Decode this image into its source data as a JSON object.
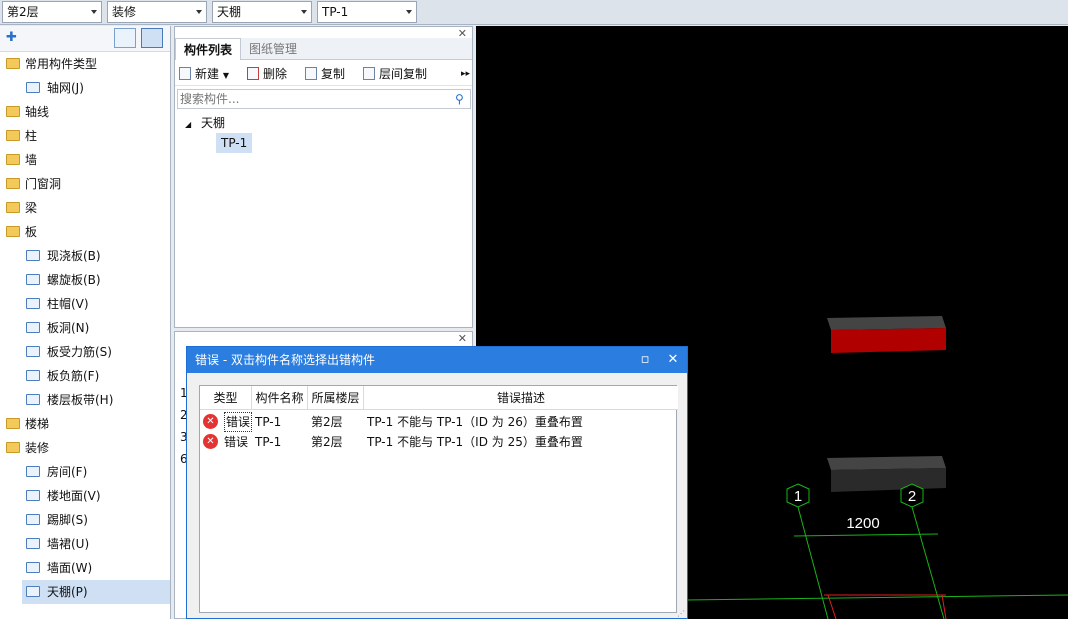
{
  "toolbar": {
    "floor": "第2层",
    "category": "装修",
    "component_type": "天棚",
    "component": "TP-1"
  },
  "left_tree": {
    "items": [
      {
        "label": "常用构件类型",
        "level": 0,
        "icon": "folder-open-icon"
      },
      {
        "label": "轴网(J)",
        "level": 1,
        "icon": "grid-icon"
      },
      {
        "label": "轴线",
        "level": 0,
        "icon": "folder-icon"
      },
      {
        "label": "柱",
        "level": 0,
        "icon": "folder-icon"
      },
      {
        "label": "墙",
        "level": 0,
        "icon": "folder-icon"
      },
      {
        "label": "门窗洞",
        "level": 0,
        "icon": "folder-icon"
      },
      {
        "label": "梁",
        "level": 0,
        "icon": "folder-icon"
      },
      {
        "label": "板",
        "level": 0,
        "icon": "folder-open-icon"
      },
      {
        "label": "现浇板(B)",
        "level": 1,
        "icon": "slab-icon"
      },
      {
        "label": "螺旋板(B)",
        "level": 1,
        "icon": "spiral-slab-icon"
      },
      {
        "label": "柱帽(V)",
        "level": 1,
        "icon": "column-cap-icon"
      },
      {
        "label": "板洞(N)",
        "level": 1,
        "icon": "slab-hole-icon"
      },
      {
        "label": "板受力筋(S)",
        "level": 1,
        "icon": "rebar-icon"
      },
      {
        "label": "板负筋(F)",
        "level": 1,
        "icon": "negative-rebar-icon"
      },
      {
        "label": "楼层板带(H)",
        "level": 1,
        "icon": "slab-strip-icon"
      },
      {
        "label": "楼梯",
        "level": 0,
        "icon": "folder-icon"
      },
      {
        "label": "装修",
        "level": 0,
        "icon": "folder-open-icon"
      },
      {
        "label": "房间(F)",
        "level": 1,
        "icon": "room-icon"
      },
      {
        "label": "楼地面(V)",
        "level": 1,
        "icon": "floor-icon"
      },
      {
        "label": "踢脚(S)",
        "level": 1,
        "icon": "skirting-icon"
      },
      {
        "label": "墙裙(U)",
        "level": 1,
        "icon": "dado-icon"
      },
      {
        "label": "墙面(W)",
        "level": 1,
        "icon": "wall-face-icon"
      },
      {
        "label": "天棚(P)",
        "level": 1,
        "icon": "ceiling-icon",
        "selected": true
      }
    ]
  },
  "component_panel": {
    "tabs": [
      "构件列表",
      "图纸管理"
    ],
    "buttons": {
      "new": "新建",
      "delete": "删除",
      "copy": "复制",
      "floor_copy": "层间复制"
    },
    "search_placeholder": "搜索构件...",
    "tree_root": "天棚",
    "tree_child": "TP-1"
  },
  "side_rows": [
    "1",
    "2",
    "3",
    "6"
  ],
  "error_dialog": {
    "title": "错误 - 双击构件名称选择出错构件",
    "columns": [
      "类型",
      "构件名称",
      "所属楼层",
      "错误描述"
    ],
    "rows": [
      {
        "type": "错误",
        "name": "TP-1",
        "floor": "第2层",
        "desc": "TP-1 不能与 TP-1（ID 为 26）重叠布置"
      },
      {
        "type": "错误",
        "name": "TP-1",
        "floor": "第2层",
        "desc": "TP-1 不能与 TP-1（ID 为 25）重叠布置"
      }
    ]
  },
  "canvas": {
    "axis_labels": [
      "1",
      "2"
    ],
    "dimension": "1200",
    "colors": {
      "background": "#000000",
      "grid_line": "#19b319",
      "selection_red": "#b00000"
    }
  }
}
